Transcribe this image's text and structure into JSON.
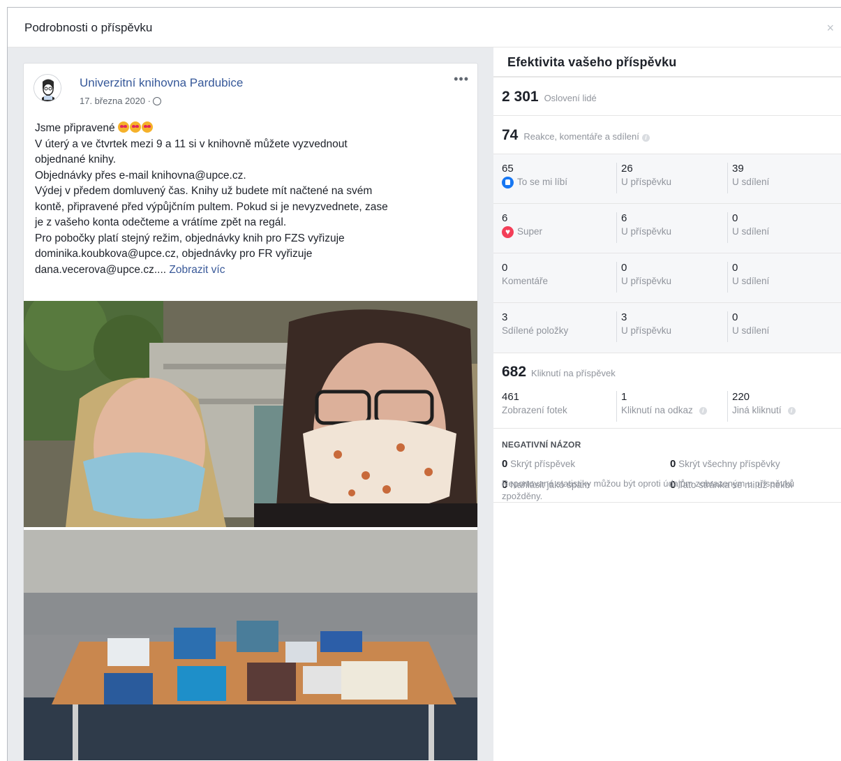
{
  "dialog": {
    "title": "Podrobnosti o příspěvku",
    "close_label": "×"
  },
  "post": {
    "page_name": "Univerzitní knihovna Pardubice",
    "date": "17. března 2020 ·",
    "more_label": "•••",
    "lines": [
      "Jsme připravené",
      "V úterý a ve čtvrtek mezi 9 a 11 si v knihovně můžete vyzvednout",
      "objednané knihy.",
      "Objednávky přes e-mail knihovna@upce.cz.",
      "Výdej v předem domluvený čas. Knihy už budete mít načtené na svém",
      "kontě, připravené před výpůjčním pultem. Pokud si je nevyzvednete, zase",
      "je z vašeho konta odečteme a vrátíme zpět na regál.",
      "Pro pobočky platí stejný režim, objednávky knih pro FZS vyřizuje",
      "dominika.koubkova@upce.cz, objednávky pro FR vyřizuje",
      "dana.vecerova@upce.cz...."
    ],
    "see_more": "Zobrazit víc"
  },
  "insights": {
    "title": "Efektivita vašeho příspěvku",
    "reach": {
      "value": "2 301",
      "label": "Oslovení lidé"
    },
    "engagement": {
      "value": "74",
      "label": "Reakce, komentáře a sdílení"
    },
    "rows": [
      {
        "total": "65",
        "label": "To se mi líbí",
        "on_post": "26",
        "on_post_label": "U příspěvku",
        "on_share": "39",
        "on_share_label": "U sdílení"
      },
      {
        "total": "6",
        "label": "Super",
        "on_post": "6",
        "on_post_label": "U příspěvku",
        "on_share": "0",
        "on_share_label": "U sdílení"
      },
      {
        "total": "0",
        "label": "Komentáře",
        "on_post": "0",
        "on_post_label": "U příspěvku",
        "on_share": "0",
        "on_share_label": "U sdílení"
      },
      {
        "total": "3",
        "label": "Sdílené položky",
        "on_post": "3",
        "on_post_label": "U příspěvku",
        "on_share": "0",
        "on_share_label": "U sdílení"
      }
    ],
    "clicks": {
      "value": "682",
      "label": "Kliknutí na příspěvek",
      "photo_views": "461",
      "photo_views_label": "Zobrazení fotek",
      "link_clicks": "1",
      "link_clicks_label": "Kliknutí na odkaz",
      "other_clicks": "220",
      "other_clicks_label": "Jiná kliknutí"
    },
    "negative": {
      "title": "NEGATIVNÍ NÁZOR",
      "hide_post": {
        "value": "0",
        "label": "Skrýt příspěvek"
      },
      "hide_all": {
        "value": "0",
        "label": "Skrýt všechny příspěvky"
      },
      "spam": {
        "value": "0",
        "label": "Nahlásit jako spam"
      },
      "unlike": {
        "value": "0",
        "label": "Tato stránka se mi už nelíbí"
      }
    },
    "footnote": "Reportované statistiky můžou být oproti údajům zobrazeným u příspěvků zpožděny."
  },
  "colors": {
    "link": "#365899",
    "like": "#1877f2",
    "love": "#f33e58",
    "muted": "#90949c"
  }
}
